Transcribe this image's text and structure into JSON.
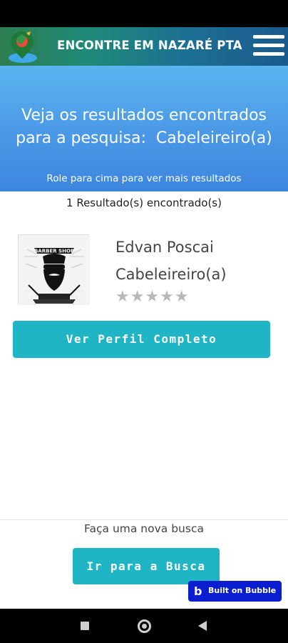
{
  "header": {
    "app_title": "ENCONTRE EM NAZARÉ PTA",
    "brand_colors": {
      "green": "#2e7d4f",
      "blue": "#1a5a8c"
    }
  },
  "hero": {
    "title_line1": "Veja os resultados encontrados",
    "title_line2_prefix": "para a pesquisa:",
    "search_term": "Cabeleireiro(a)",
    "scroll_hint": "Role para cima para ver mais resultados"
  },
  "results": {
    "count_text": "1 Resultado(s) encontrado(s)",
    "items": [
      {
        "thumb_text": "BARBER SHOP",
        "name": "Edvan Poscai",
        "category": "Cabeleireiro(a)",
        "rating": 0,
        "rating_max": 5,
        "stars": "★★★★★",
        "button_label": "Ver Perfil Completo"
      }
    ]
  },
  "footer": {
    "new_search_label": "Faça uma nova busca",
    "search_button_label": "Ir para a Busca"
  },
  "badge": {
    "logo": "b",
    "label": "Built on Bubble"
  },
  "colors": {
    "button": "#1fb5c4",
    "hero_top": "#5ab4ee",
    "hero_bottom": "#3d86e0",
    "badge": "#0a1ecf",
    "star_empty": "#b8b8b8"
  },
  "icons": {
    "menu": "hamburger-menu-icon",
    "logo": "map-pin-logo-icon",
    "nav_recents": "square-recents-icon",
    "nav_home": "circle-home-icon",
    "nav_back": "triangle-back-icon"
  }
}
